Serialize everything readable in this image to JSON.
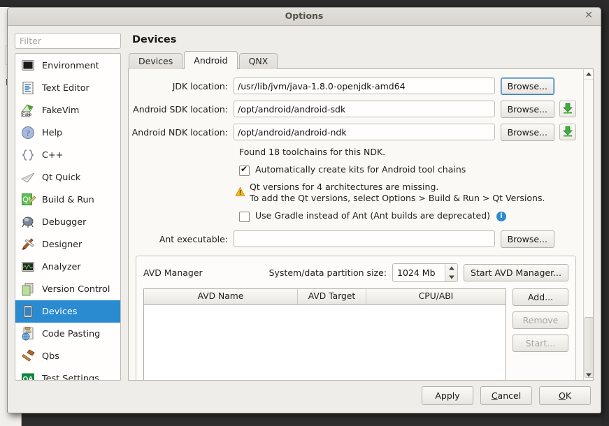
{
  "window": {
    "title": "Options",
    "close_icon": "close-icon"
  },
  "sidebar": {
    "filter_placeholder": "Filter",
    "filter_value": "",
    "items": [
      {
        "label": "Environment",
        "icon": "monitor-icon",
        "selected": false
      },
      {
        "label": "Text Editor",
        "icon": "text-document-icon",
        "selected": false
      },
      {
        "label": "FakeVim",
        "icon": "fakevim-icon",
        "selected": false
      },
      {
        "label": "Help",
        "icon": "question-mark-icon",
        "selected": false
      },
      {
        "label": "C++",
        "icon": "braces-icon",
        "selected": false
      },
      {
        "label": "Qt Quick",
        "icon": "paper-plane-icon",
        "selected": false
      },
      {
        "label": "Build & Run",
        "icon": "qt-build-icon",
        "selected": false
      },
      {
        "label": "Debugger",
        "icon": "bug-icon",
        "selected": false
      },
      {
        "label": "Designer",
        "icon": "pencil-ruler-icon",
        "selected": false
      },
      {
        "label": "Analyzer",
        "icon": "oscilloscope-icon",
        "selected": false
      },
      {
        "label": "Version Control",
        "icon": "copy-pages-icon",
        "selected": false
      },
      {
        "label": "Devices",
        "icon": "tablet-device-icon",
        "selected": true
      },
      {
        "label": "Code Pasting",
        "icon": "clipboard-globe-icon",
        "selected": false
      },
      {
        "label": "Qbs",
        "icon": "hammer-icon",
        "selected": false
      },
      {
        "label": "Test Settings",
        "icon": "qa-badge-icon",
        "selected": false
      }
    ]
  },
  "page": {
    "title": "Devices",
    "tabs": [
      {
        "label": "Devices",
        "active": false
      },
      {
        "label": "Android",
        "active": true
      },
      {
        "label": "QNX",
        "active": false
      }
    ]
  },
  "android": {
    "jdk": {
      "label": "JDK location:",
      "value": "/usr/lib/jvm/java-1.8.0-openjdk-amd64",
      "browse_label": "Browse..."
    },
    "sdk": {
      "label": "Android SDK location:",
      "value": "/opt/android/android-sdk",
      "browse_label": "Browse...",
      "download_icon": "download-arrow-icon"
    },
    "ndk": {
      "label": "Android NDK location:",
      "value": "/opt/android/android-ndk",
      "browse_label": "Browse...",
      "download_icon": "download-arrow-icon"
    },
    "toolchains_info": "Found 18 toolchains for this NDK.",
    "auto_kits": {
      "label": "Automatically create kits for Android tool chains",
      "checked": true
    },
    "warning": {
      "icon": "warning-triangle-icon",
      "line1": "Qt versions for 4 architectures are missing.",
      "line2": "To add the Qt versions, select Options > Build & Run > Qt Versions."
    },
    "gradle": {
      "label": "Use Gradle instead of Ant (Ant builds are deprecated)",
      "checked": false,
      "info_icon": "info-icon",
      "info_glyph": "i"
    },
    "ant": {
      "label": "Ant executable:",
      "value": "",
      "browse_label": "Browse..."
    },
    "avd": {
      "group_label": "AVD Manager",
      "partition_label": "System/data partition size:",
      "partition_value": "1024 Mb",
      "start_manager_label": "Start AVD Manager...",
      "columns": [
        "AVD Name",
        "AVD Target",
        "CPU/ABI"
      ],
      "rows": [],
      "buttons": [
        {
          "label": "Add...",
          "disabled": false
        },
        {
          "label": "Remove",
          "disabled": true
        },
        {
          "label": "Start...",
          "disabled": true
        }
      ]
    }
  },
  "footer": {
    "apply_label": "Apply",
    "cancel_mnemonic": "C",
    "cancel_rest": "ancel",
    "ok_mnemonic": "O",
    "ok_rest": "K"
  },
  "colors": {
    "accent_selection": "#2a8bd0",
    "window_bg": "#efedea",
    "panel_bg": "#fbf9f6",
    "warning": "#f0b323",
    "download_green": "#3fae3f"
  }
}
